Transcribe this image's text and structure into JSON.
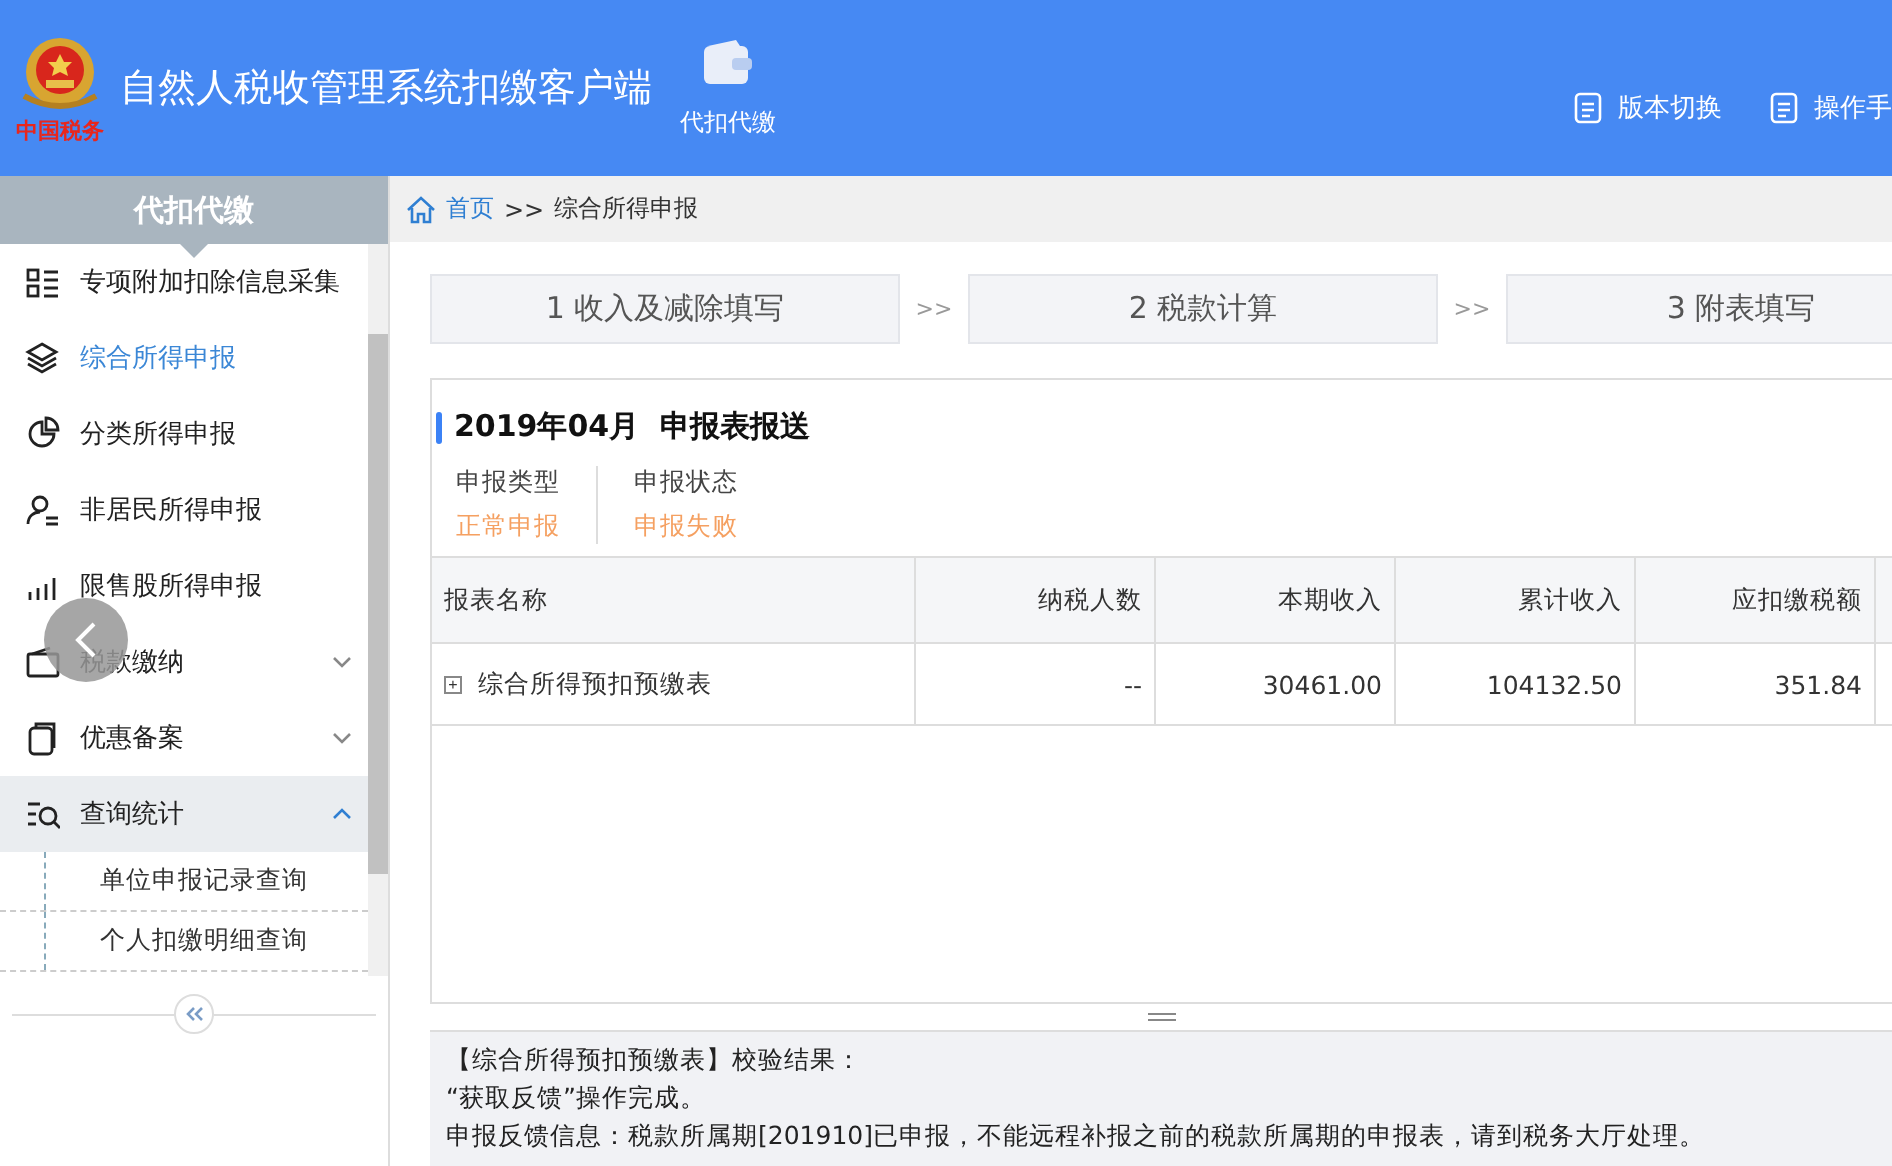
{
  "header": {
    "logo_text": "中国税务",
    "title": "自然人税收管理系统扣缴客户端",
    "module": "代扣代缴",
    "actions": [
      "版本切换",
      "操作手"
    ]
  },
  "sidebar": {
    "title": "代扣代缴",
    "items": [
      {
        "label": "专项附加扣除信息采集",
        "selected": false
      },
      {
        "label": "综合所得申报",
        "selected": true
      },
      {
        "label": "分类所得申报",
        "selected": false
      },
      {
        "label": "非居民所得申报",
        "selected": false
      },
      {
        "label": "限售股所得申报",
        "selected": false
      },
      {
        "label": "税款缴纳",
        "selected": false,
        "expanded": false
      },
      {
        "label": "优惠备案",
        "selected": false,
        "expanded": false
      },
      {
        "label": "查询统计",
        "selected": false,
        "expanded": true,
        "children": [
          {
            "label": "单位申报记录查询"
          },
          {
            "label": "个人扣缴明细查询"
          }
        ]
      }
    ]
  },
  "breadcrumb": {
    "home": "首页",
    "separator": ">>",
    "current": "综合所得申报"
  },
  "steps": [
    {
      "label": "1 收入及减除填写"
    },
    {
      "label": "2 税款计算"
    },
    {
      "label": "3 附表填写"
    }
  ],
  "step_separator": ">>",
  "report": {
    "period": "2019年04月",
    "title": "申报表报送",
    "info": [
      {
        "label": "申报类型",
        "value": "正常申报"
      },
      {
        "label": "申报状态",
        "value": "申报失败"
      }
    ],
    "table": {
      "columns": [
        "报表名称",
        "纳税人数",
        "本期收入",
        "累计收入",
        "应扣缴税额"
      ],
      "rows": [
        {
          "expand": "+",
          "cells": [
            "综合所得预扣预缴表",
            "--",
            "30461.00",
            "104132.50",
            "351.84"
          ]
        }
      ]
    }
  },
  "messages": [
    "【综合所得预扣预缴表】校验结果：",
    "“获取反馈”操作完成。",
    "申报反馈信息：税款所属期[201910]已申报，不能远程补报之前的税款所属期的申报表，请到税务大厅处理。"
  ]
}
